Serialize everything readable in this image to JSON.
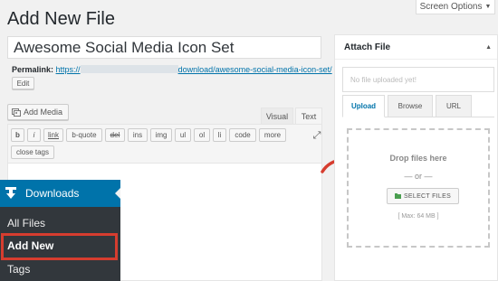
{
  "header": {
    "title": "Add New File",
    "screen_options": "Screen Options",
    "screen_options_arrow": "▼"
  },
  "post": {
    "title": "Awesome Social Media Icon Set",
    "permalink_label": "Permalink:",
    "permalink_prefix": "https://",
    "permalink_suffix": "download/awesome-social-media-icon-set/",
    "edit_label": "Edit"
  },
  "editor": {
    "add_media_label": "Add Media",
    "tab_visual": "Visual",
    "tab_text": "Text",
    "quicktags": [
      {
        "label": "b",
        "name": "bold"
      },
      {
        "label": "i",
        "name": "italic"
      },
      {
        "label": "link",
        "name": "link"
      },
      {
        "label": "b-quote",
        "name": "blockquote"
      },
      {
        "label": "del",
        "name": "del"
      },
      {
        "label": "ins",
        "name": "ins"
      },
      {
        "label": "img",
        "name": "img"
      },
      {
        "label": "ul",
        "name": "ul"
      },
      {
        "label": "ol",
        "name": "ol"
      },
      {
        "label": "li",
        "name": "li"
      },
      {
        "label": "code",
        "name": "code"
      },
      {
        "label": "more",
        "name": "more"
      }
    ],
    "close_tags_label": "close tags",
    "fullscreen_icon": "⤢"
  },
  "menu": {
    "current": "Downloads",
    "items": [
      {
        "label": "All Files"
      },
      {
        "label": "Add New"
      },
      {
        "label": "Tags"
      }
    ],
    "highlight_color": "#d63d2f",
    "accent_color": "#0073aa"
  },
  "attach": {
    "title": "Attach File",
    "toggle_arrow": "▲",
    "file_placeholder": "No file uploaded yet!",
    "tabs": {
      "upload": "Upload",
      "browse": "Browse",
      "url": "URL"
    },
    "drop_text": "Drop files here",
    "or_text": "— or —",
    "select_button": "SELECT FILES",
    "max_size": "[ Max: 64 MB ]"
  }
}
